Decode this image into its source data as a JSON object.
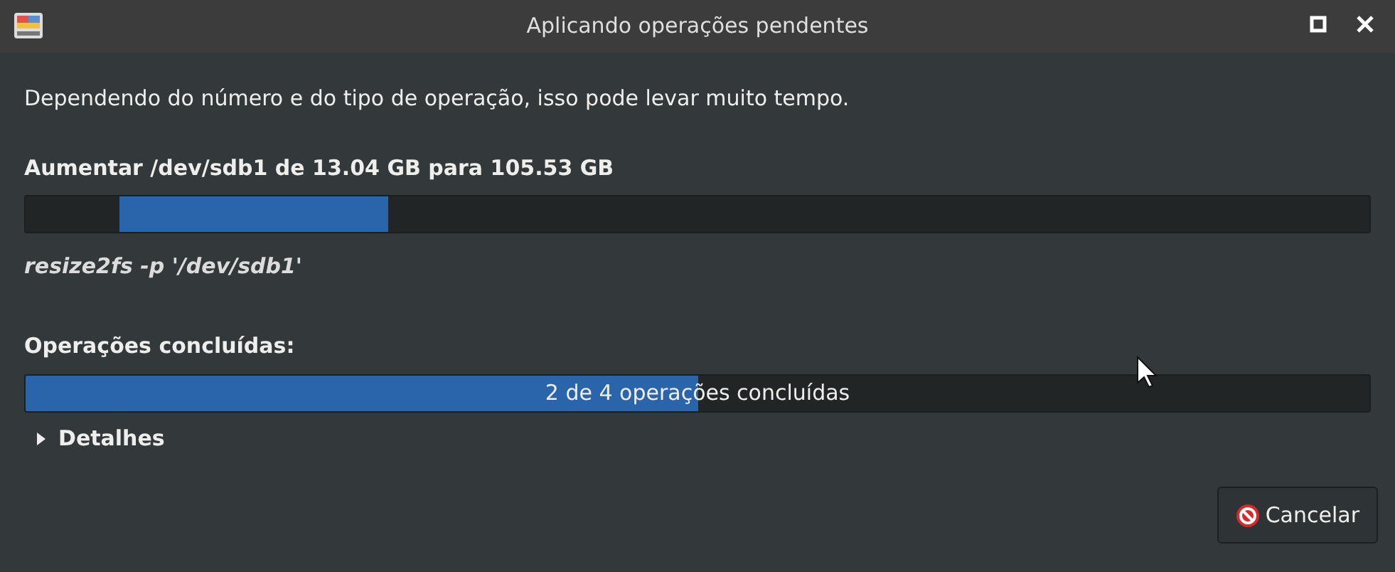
{
  "window": {
    "title": "Aplicando operações pendentes"
  },
  "description": "Dependendo do número e do tipo de operação, isso pode levar muito tempo.",
  "current_operation": {
    "label": "Aumentar /dev/sdb1 de 13.04 GB para 105.53 GB",
    "command": "resize2fs -p '/dev/sdb1'"
  },
  "completed": {
    "label": "Operações concluídas:",
    "level": 0.5,
    "text": "2 de 4 operações concluídas"
  },
  "details": {
    "label": "Detalhes",
    "expanded": false
  },
  "buttons": [
    {
      "label": "Cancelar"
    }
  ]
}
